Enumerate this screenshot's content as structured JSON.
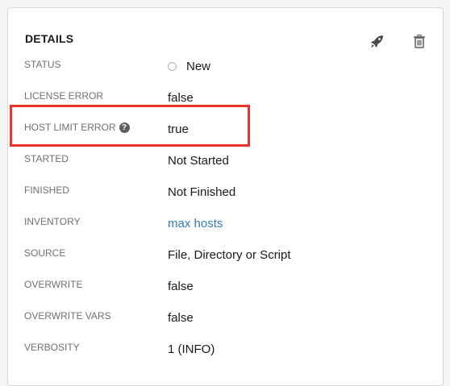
{
  "card": {
    "title": "DETAILS",
    "actions": [
      {
        "name": "launch",
        "icon": "rocket-icon"
      },
      {
        "name": "delete",
        "icon": "trash-icon"
      }
    ]
  },
  "details": [
    {
      "key": "status",
      "label": "STATUS",
      "value": "New",
      "status_icon": "circle-icon"
    },
    {
      "key": "license_error",
      "label": "LICENSE ERROR",
      "value": "false"
    },
    {
      "key": "host_limit_error",
      "label": "HOST LIMIT ERROR",
      "value": "true",
      "help_icon": "question-circle-icon",
      "help_glyph": "?"
    },
    {
      "key": "started",
      "label": "STARTED",
      "value": "Not Started"
    },
    {
      "key": "finished",
      "label": "FINISHED",
      "value": "Not Finished"
    },
    {
      "key": "inventory",
      "label": "INVENTORY",
      "value": "max hosts",
      "is_link": true
    },
    {
      "key": "source",
      "label": "SOURCE",
      "value": "File, Directory or Script"
    },
    {
      "key": "overwrite",
      "label": "OVERWRITE",
      "value": "false"
    },
    {
      "key": "overwrite_vars",
      "label": "OVERWRITE VARS",
      "value": "false"
    },
    {
      "key": "verbosity",
      "label": "VERBOSITY",
      "value": "1 (INFO)"
    }
  ],
  "highlight": {
    "color": "#e8342a",
    "target": "host_limit_error"
  },
  "colors": {
    "link": "#337ab7",
    "label": "#707070",
    "text": "#161b1f"
  }
}
